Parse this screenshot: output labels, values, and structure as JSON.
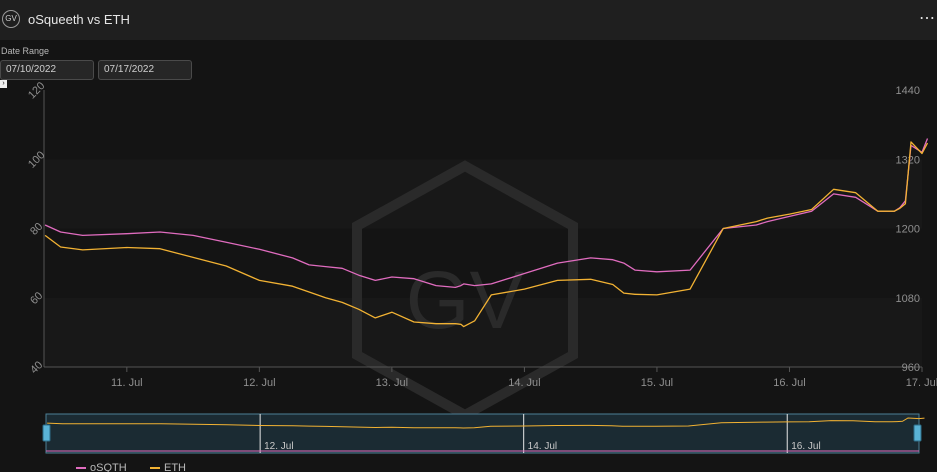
{
  "header": {
    "logo_text": "GV",
    "title": "oSqueeth vs ETH",
    "menu_label": "⋯"
  },
  "date_range": {
    "label": "Date Range",
    "start": "07/10/2022",
    "end": "07/17/2022"
  },
  "watermark": "GV",
  "colors": {
    "osqth": "#e06cbf",
    "eth": "#f2b233",
    "background": "#141414",
    "header": "#1f1f1f"
  },
  "chart_data": {
    "type": "line",
    "x_label_ticks": [
      "11. Jul",
      "12. Jul",
      "13. Jul",
      "14. Jul",
      "15. Jul",
      "16. Jul",
      "17. Jul"
    ],
    "x_range": [
      "2022-07-10T09:00",
      "2022-07-17T00:00"
    ],
    "y_left": {
      "ticks": [
        40,
        60,
        80,
        100,
        120
      ],
      "range": [
        40,
        120
      ]
    },
    "y_right": {
      "ticks": [
        960,
        1080,
        1200,
        1320,
        1440
      ],
      "range": [
        960,
        1440
      ]
    },
    "legend_position": "bottom-left",
    "navigator_labels": [
      "12. Jul",
      "14. Jul",
      "16. Jul"
    ],
    "series": [
      {
        "name": "oSQTH",
        "axis": "left",
        "x": [
          "2022-07-10T09:12",
          "2022-07-10T12:00",
          "2022-07-10T16:00",
          "2022-07-11T00:00",
          "2022-07-11T06:00",
          "2022-07-11T12:00",
          "2022-07-11T18:00",
          "2022-07-12T00:00",
          "2022-07-12T06:00",
          "2022-07-12T09:00",
          "2022-07-12T12:00",
          "2022-07-12T15:00",
          "2022-07-12T18:00",
          "2022-07-12T21:00",
          "2022-07-13T00:00",
          "2022-07-13T04:00",
          "2022-07-13T08:00",
          "2022-07-13T11:30",
          "2022-07-13T12:30",
          "2022-07-13T13:00",
          "2022-07-13T15:00",
          "2022-07-13T18:00",
          "2022-07-14T00:00",
          "2022-07-14T06:00",
          "2022-07-14T12:00",
          "2022-07-14T16:00",
          "2022-07-14T18:00",
          "2022-07-14T20:00",
          "2022-07-15T00:00",
          "2022-07-15T06:00",
          "2022-07-15T12:00",
          "2022-07-15T18:00",
          "2022-07-15T20:00",
          "2022-07-16T00:00",
          "2022-07-16T04:00",
          "2022-07-16T08:00",
          "2022-07-16T12:00",
          "2022-07-16T16:00",
          "2022-07-16T19:00",
          "2022-07-16T20:00",
          "2022-07-16T21:00",
          "2022-07-16T22:00",
          "2022-07-17T00:00",
          "2022-07-17T01:00"
        ],
        "values": [
          81,
          79,
          78,
          78.5,
          79,
          78,
          76,
          74,
          71.5,
          69.5,
          69,
          68.5,
          66.5,
          65,
          66,
          65.5,
          63.5,
          63,
          63.5,
          64,
          63.5,
          64,
          67,
          70,
          71.5,
          71,
          70,
          68,
          67.5,
          68,
          80,
          81,
          82,
          83.5,
          85,
          90,
          89,
          85,
          85,
          86,
          88,
          104,
          102,
          106
        ]
      },
      {
        "name": "ETH",
        "axis": "right",
        "x": [
          "2022-07-10T09:12",
          "2022-07-10T12:00",
          "2022-07-10T16:00",
          "2022-07-11T00:00",
          "2022-07-11T06:00",
          "2022-07-11T12:00",
          "2022-07-11T18:00",
          "2022-07-12T00:00",
          "2022-07-12T06:00",
          "2022-07-12T09:00",
          "2022-07-12T12:00",
          "2022-07-12T15:00",
          "2022-07-12T18:00",
          "2022-07-12T21:00",
          "2022-07-13T00:00",
          "2022-07-13T04:00",
          "2022-07-13T08:00",
          "2022-07-13T11:30",
          "2022-07-13T12:30",
          "2022-07-13T13:00",
          "2022-07-13T15:00",
          "2022-07-13T18:00",
          "2022-07-14T00:00",
          "2022-07-14T06:00",
          "2022-07-14T12:00",
          "2022-07-14T16:00",
          "2022-07-14T18:00",
          "2022-07-14T20:00",
          "2022-07-15T00:00",
          "2022-07-15T06:00",
          "2022-07-15T12:00",
          "2022-07-15T18:00",
          "2022-07-15T20:00",
          "2022-07-16T00:00",
          "2022-07-16T04:00",
          "2022-07-16T08:00",
          "2022-07-16T12:00",
          "2022-07-16T16:00",
          "2022-07-16T19:00",
          "2022-07-16T20:00",
          "2022-07-16T21:00",
          "2022-07-16T22:00",
          "2022-07-17T00:00",
          "2022-07-17T01:00"
        ],
        "values": [
          1188,
          1168,
          1163,
          1167,
          1165,
          1150,
          1135,
          1110,
          1100,
          1090,
          1080,
          1072,
          1060,
          1045,
          1055,
          1038,
          1035,
          1035,
          1034,
          1030,
          1040,
          1085,
          1095,
          1110,
          1112,
          1103,
          1088,
          1086,
          1085,
          1095,
          1200,
          1212,
          1218,
          1225,
          1233,
          1268,
          1262,
          1230,
          1230,
          1235,
          1243,
          1350,
          1330,
          1348
        ]
      }
    ]
  }
}
